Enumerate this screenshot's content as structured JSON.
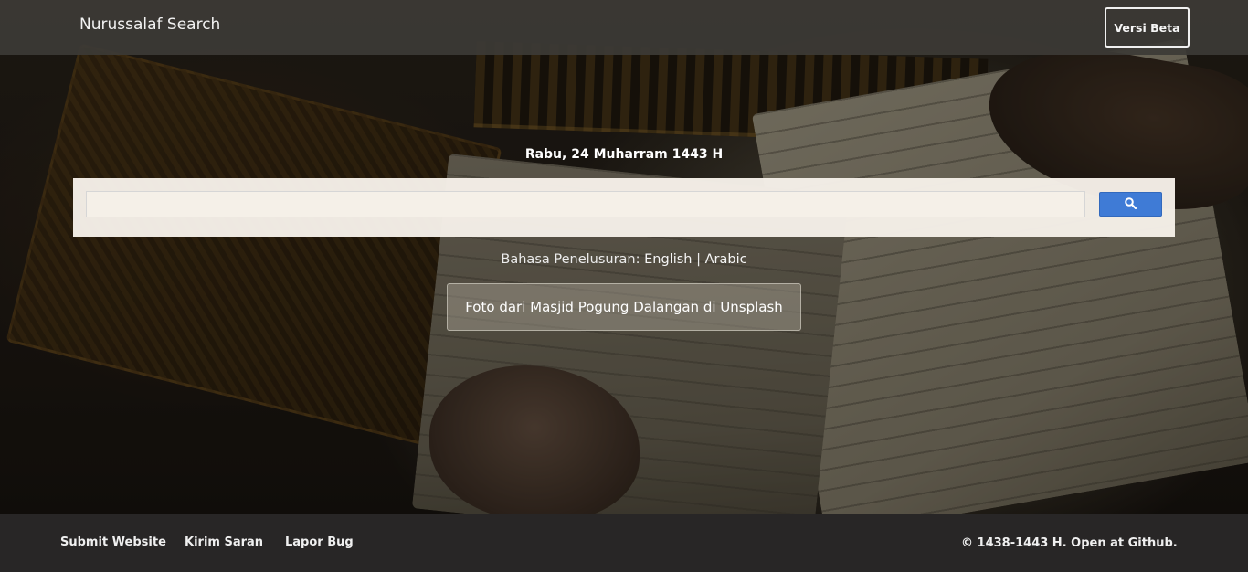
{
  "navbar": {
    "brand": "Nurussalaf Search",
    "beta_button": "Versi Beta"
  },
  "hero": {
    "date": "Rabu, 24 Muharram 1443 H",
    "search": {
      "value": "",
      "button_icon": "search-icon"
    },
    "language": {
      "label": "Bahasa Penelusuran:",
      "english": "English",
      "separator": "|",
      "arabic": "Arabic"
    },
    "photo_credit": "Foto dari Masjid Pogung Dalangan di Unsplash"
  },
  "footer": {
    "links": [
      "Submit Website",
      "Kirim Saran",
      "Lapor Bug"
    ],
    "copyright": "© 1438-1443 H. Open at",
    "github": "Github."
  },
  "colors": {
    "search_button": "#3f7bd6",
    "navbar": "#3c3a36",
    "footer": "#282626"
  }
}
